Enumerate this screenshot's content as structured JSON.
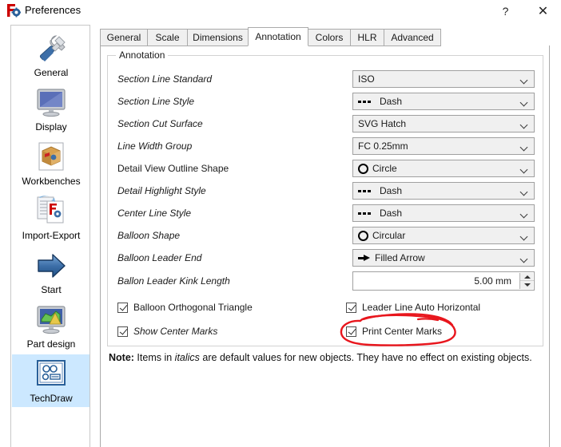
{
  "window": {
    "title": "Preferences",
    "icon": "freecad-icon",
    "help_label": "?",
    "close_label": "✕"
  },
  "sidebar": {
    "items": [
      {
        "label": "General",
        "icon": "tools-icon",
        "selected": false
      },
      {
        "label": "Display",
        "icon": "monitor-icon",
        "selected": false
      },
      {
        "label": "Workbenches",
        "icon": "box-icon",
        "selected": false
      },
      {
        "label": "Import-Export",
        "icon": "import-export-icon",
        "selected": false
      },
      {
        "label": "Start",
        "icon": "arrow-right-icon",
        "selected": false
      },
      {
        "label": "Part design",
        "icon": "part-design-icon",
        "selected": false
      },
      {
        "label": "TechDraw",
        "icon": "techdraw-icon",
        "selected": true
      }
    ]
  },
  "tabs": [
    {
      "label": "General",
      "active": false
    },
    {
      "label": "Scale",
      "active": false
    },
    {
      "label": "Dimensions",
      "active": false
    },
    {
      "label": "Annotation",
      "active": true
    },
    {
      "label": "Colors",
      "active": false
    },
    {
      "label": "HLR",
      "active": false
    },
    {
      "label": "Advanced",
      "active": false
    }
  ],
  "group": {
    "title": "Annotation",
    "rows": [
      {
        "label": "Section Line Standard",
        "italic": true,
        "value": "ISO",
        "glyph": "none"
      },
      {
        "label": "Section Line Style",
        "italic": true,
        "value": "Dash",
        "glyph": "dash"
      },
      {
        "label": "Section Cut Surface",
        "italic": true,
        "value": "SVG Hatch",
        "glyph": "none"
      },
      {
        "label": "Line Width Group",
        "italic": true,
        "value": "FC 0.25mm",
        "glyph": "none"
      },
      {
        "label": "Detail View Outline Shape",
        "italic": false,
        "value": "Circle",
        "glyph": "circle"
      },
      {
        "label": "Detail Highlight Style",
        "italic": true,
        "value": "Dash",
        "glyph": "dash"
      },
      {
        "label": "Center Line Style",
        "italic": true,
        "value": "Dash",
        "glyph": "dash"
      },
      {
        "label": "Balloon Shape",
        "italic": true,
        "value": "Circular",
        "glyph": "circle"
      },
      {
        "label": "Balloon Leader End",
        "italic": true,
        "value": "Filled Arrow",
        "glyph": "arrow"
      }
    ],
    "spin_row": {
      "label": "Ballon Leader Kink Length",
      "italic": true,
      "value": "5.00 mm"
    },
    "checkboxes": [
      {
        "label": "Balloon Orthogonal Triangle",
        "checked": true,
        "italic": false,
        "col": "left",
        "row": 0
      },
      {
        "label": "Leader Line Auto Horizontal",
        "checked": true,
        "italic": false,
        "col": "right",
        "row": 0
      },
      {
        "label": "Show Center Marks",
        "checked": true,
        "italic": true,
        "col": "left",
        "row": 1
      },
      {
        "label": "Print Center Marks",
        "checked": true,
        "italic": false,
        "col": "right",
        "row": 1
      }
    ]
  },
  "note": {
    "prefix": "Note:",
    "part1": " Items in ",
    "emphasis": "italics",
    "part2": " are default values for new objects. They have no effect on existing objects."
  },
  "annotation_mark": {
    "shape": "hand-drawn-ellipse",
    "color": "#e8161d",
    "targets": "Print Center Marks"
  },
  "colors": {
    "accent_selected": "#cce8ff",
    "panel_border": "#aaaaaa",
    "combo_bg": "#f0f0f0",
    "group_border": "#d2d2d2",
    "red_mark": "#e8161d"
  }
}
